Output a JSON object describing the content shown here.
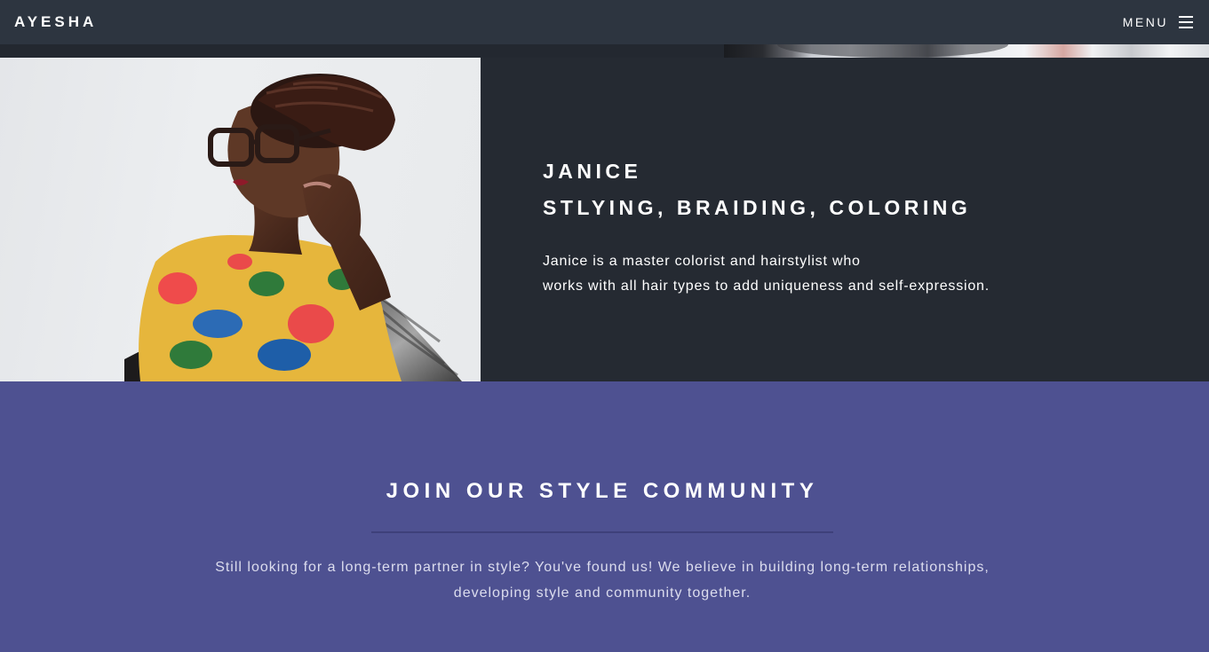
{
  "header": {
    "brand": "AYESHA",
    "menu_label": "MENU",
    "menu_icon": "hamburger-icon"
  },
  "feature": {
    "image_alt": "Portrait of Janice wearing glasses and a floral top",
    "name": "JANICE",
    "specialties": "STLYING, BRAIDING, COLORING",
    "description_line1": "Janice is a master colorist and hairstylist who",
    "description_line2": "works with all hair types to add uniqueness and self-expression."
  },
  "community": {
    "title": "JOIN OUR STYLE COMMUNITY",
    "text_line1": "Still looking for a long-term partner in style? You've found us! We believe in building long-term relationships,",
    "text_line2": "developing style and community together."
  },
  "colors": {
    "header_bg": "#2d3540",
    "feature_bg": "#252a32",
    "community_bg": "#4e5191",
    "divider": "#3e407a"
  }
}
